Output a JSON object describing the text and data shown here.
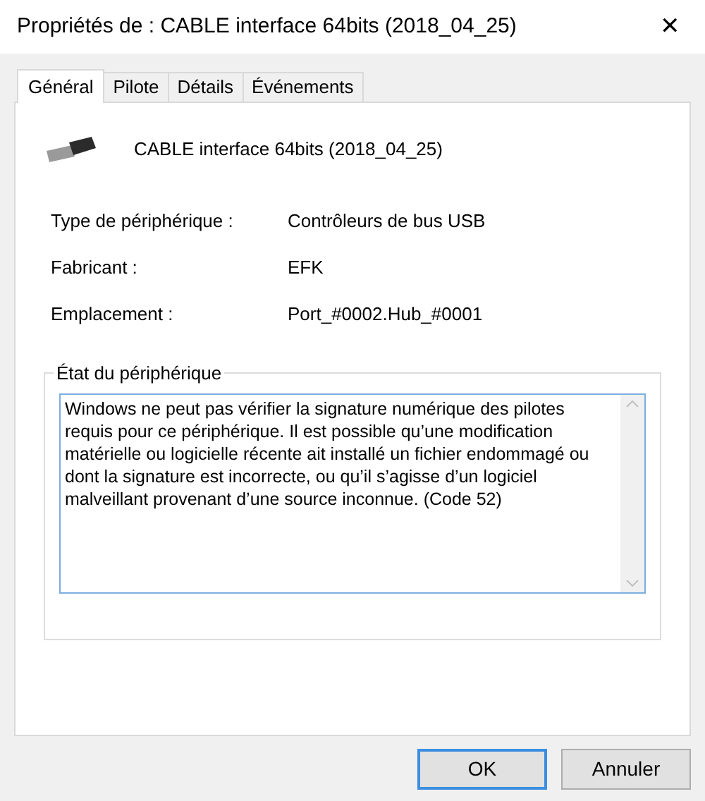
{
  "window": {
    "title": "Propriétés de : CABLE interface 64bits (2018_04_25)",
    "close": "✕"
  },
  "tabs": [
    {
      "label": "Général",
      "selected": true
    },
    {
      "label": "Pilote",
      "selected": false
    },
    {
      "label": "Détails",
      "selected": false
    },
    {
      "label": "Événements",
      "selected": false
    }
  ],
  "device": {
    "name": "CABLE interface 64bits (2018_04_25)"
  },
  "properties": [
    {
      "label": "Type de périphérique :",
      "value": "Contrôleurs de bus USB"
    },
    {
      "label": "Fabricant :",
      "value": "EFK"
    },
    {
      "label": "Emplacement :",
      "value": "Port_#0002.Hub_#0001"
    }
  ],
  "status": {
    "title": "État du périphérique",
    "text": "Windows ne peut pas vérifier la signature numérique des pilotes requis pour ce périphérique. Il est possible qu’une modification matérielle ou logicielle récente ait installé un fichier endommagé ou dont la signature est incorrecte, ou qu’il s’agisse d’un logiciel malveillant provenant d’une source inconnue. (Code 52)"
  },
  "buttons": [
    {
      "label": "OK",
      "selected": true
    },
    {
      "label": "Annuler",
      "selected": false
    }
  ]
}
